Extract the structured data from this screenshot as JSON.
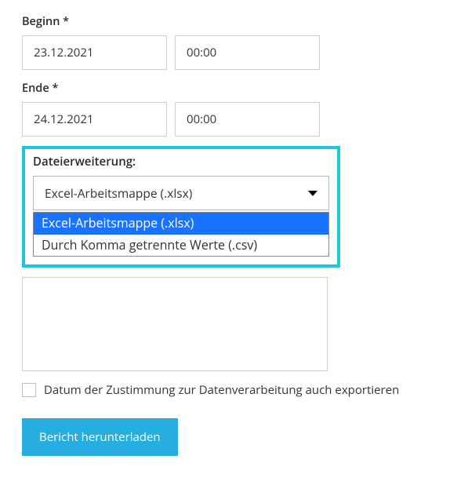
{
  "begin": {
    "label": "Beginn *",
    "date": "23.12.2021",
    "time": "00:00"
  },
  "end": {
    "label": "Ende *",
    "date": "24.12.2021",
    "time": "00:00"
  },
  "fileExt": {
    "label": "Dateierweiterung:",
    "selected": "Excel-Arbeitsmappe (.xlsx)",
    "options": [
      "Excel-Arbeitsmappe (.xlsx)",
      "Durch Komma getrennte Werte (.csv)"
    ]
  },
  "consentCheckbox": {
    "checked": false,
    "label": "Datum der Zustimmung zur Datenverarbeitung auch exportieren"
  },
  "downloadButton": "Bericht herunterladen"
}
